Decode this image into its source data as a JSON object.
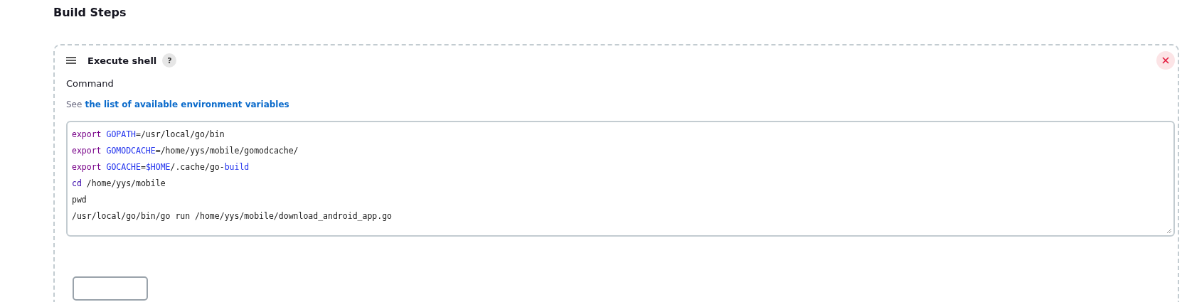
{
  "section_title": "Build Steps",
  "step": {
    "title": "Execute shell",
    "help": "?",
    "field_label": "Command",
    "hint_prefix": "See",
    "hint_link": "the list of available environment variables",
    "code_lines": [
      [
        {
          "kind": "keyword",
          "text": "export "
        },
        {
          "kind": "variable",
          "text": "GOPATH"
        },
        {
          "kind": "plain",
          "text": "=/usr/local/go/bin"
        }
      ],
      [
        {
          "kind": "keyword",
          "text": "export "
        },
        {
          "kind": "variable",
          "text": "GOMODCACHE"
        },
        {
          "kind": "plain",
          "text": "=/home/yys/mobile/gomodcache/"
        }
      ],
      [
        {
          "kind": "keyword",
          "text": "export "
        },
        {
          "kind": "variable",
          "text": "GOCACHE"
        },
        {
          "kind": "plain",
          "text": "="
        },
        {
          "kind": "variable",
          "text": "$HOME"
        },
        {
          "kind": "plain",
          "text": "/.cache/go-"
        },
        {
          "kind": "variable",
          "text": "build"
        }
      ],
      [
        {
          "kind": "builtin",
          "text": "cd"
        },
        {
          "kind": "plain",
          "text": " /home/yys/mobile"
        }
      ],
      [
        {
          "kind": "plain",
          "text": "pwd"
        }
      ],
      [
        {
          "kind": "plain",
          "text": "/usr/local/go/bin/go run /home/yys/mobile/download_android_app.go"
        }
      ]
    ]
  }
}
